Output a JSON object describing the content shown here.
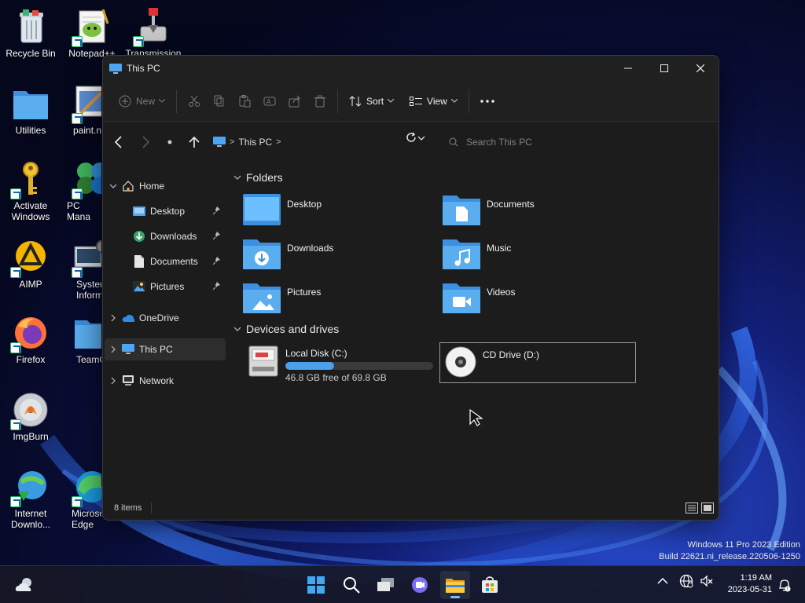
{
  "desktop": {
    "icons": [
      {
        "label": "Recycle Bin"
      },
      {
        "label": "Notepad++"
      },
      {
        "label": "Transmission"
      },
      {
        "label": "Utilities"
      },
      {
        "label": "paint.n"
      },
      {
        "label": "Activate Windows"
      },
      {
        "label": "PC Mana"
      },
      {
        "label": "AIMP"
      },
      {
        "label": "Syster Inform"
      },
      {
        "label": "Firefox"
      },
      {
        "label": "TeamO"
      },
      {
        "label": "ImgBurn"
      },
      {
        "label": "Internet Downlo..."
      },
      {
        "label": "Microso Edge"
      }
    ],
    "watermark": {
      "line1": "Windows 11 Pro 2023 Edition",
      "line2": "Build 22621.ni_release.220506-1250"
    }
  },
  "window": {
    "title": "This PC",
    "commands": {
      "new": "New",
      "sort": "Sort",
      "view": "View"
    },
    "address": {
      "location": "This PC",
      "breadcrumb_sep": ">"
    },
    "search": {
      "placeholder": "Search This PC"
    },
    "sidebar": {
      "items": [
        {
          "label": "Home"
        },
        {
          "label": "Desktop"
        },
        {
          "label": "Downloads"
        },
        {
          "label": "Documents"
        },
        {
          "label": "Pictures"
        },
        {
          "label": "OneDrive"
        },
        {
          "label": "This PC"
        },
        {
          "label": "Network"
        }
      ]
    },
    "folders_header": "Folders",
    "folders": [
      {
        "name": "Desktop"
      },
      {
        "name": "Documents"
      },
      {
        "name": "Downloads"
      },
      {
        "name": "Music"
      },
      {
        "name": "Pictures"
      },
      {
        "name": "Videos"
      }
    ],
    "drives_header": "Devices and drives",
    "drives": [
      {
        "name": "Local Disk (C:)",
        "free": "46.8 GB free of 69.8 GB",
        "used_fraction": 0.33
      },
      {
        "name": "CD Drive (D:)"
      }
    ],
    "status": {
      "items": "8 items"
    }
  },
  "taskbar": {
    "clock": {
      "time": "1:19 AM",
      "date": "2023-05-31"
    }
  },
  "colors": {
    "accent": "#4c9fe8",
    "folder": "#5aaef0",
    "window_bg": "#1c1c1c"
  }
}
